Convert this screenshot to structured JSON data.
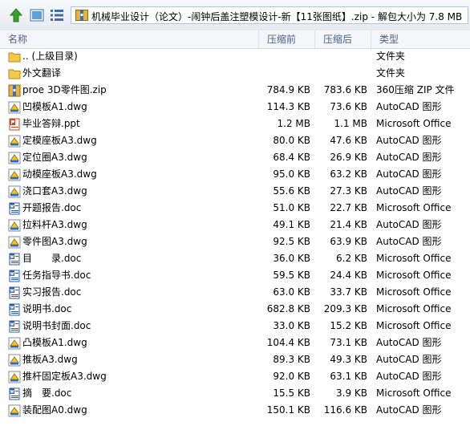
{
  "window": {
    "path": "机械毕业设计（论文）-闹钟后盖注塑模设计-新【11张图纸】.zip - 解包大小为 7.8 MB"
  },
  "toolbar": {
    "up_icon": "up-arrow-icon",
    "view1_icon": "thumbnail-view-icon",
    "view2_icon": "details-view-icon"
  },
  "columns": {
    "name": "名称",
    "packed": "压缩前",
    "size": "压缩后",
    "type": "类型"
  },
  "files": [
    {
      "name": ".. (上级目录)",
      "packed": "",
      "size": "",
      "type": "文件夹",
      "icon": "folder-icon"
    },
    {
      "name": "外文翻译",
      "packed": "",
      "size": "",
      "type": "文件夹",
      "icon": "folder-icon"
    },
    {
      "name": "proe 3D零件图.zip",
      "packed": "784.9 KB",
      "size": "783.6 KB",
      "type": "360压缩 ZIP 文件",
      "icon": "zip-icon"
    },
    {
      "name": "凹模板A1.dwg",
      "packed": "114.3 KB",
      "size": "73.6 KB",
      "type": "AutoCAD 图形",
      "icon": "dwg-icon"
    },
    {
      "name": "毕业答辩.ppt",
      "packed": "1.2 MB",
      "size": "1.1 MB",
      "type": "Microsoft Office",
      "icon": "ppt-icon"
    },
    {
      "name": "定模座板A3.dwg",
      "packed": "80.0 KB",
      "size": "47.6 KB",
      "type": "AutoCAD 图形",
      "icon": "dwg-icon"
    },
    {
      "name": "定位圈A3.dwg",
      "packed": "68.4 KB",
      "size": "26.9 KB",
      "type": "AutoCAD 图形",
      "icon": "dwg-icon"
    },
    {
      "name": "动模座板A3.dwg",
      "packed": "95.0 KB",
      "size": "63.2 KB",
      "type": "AutoCAD 图形",
      "icon": "dwg-icon"
    },
    {
      "name": "浇口套A3.dwg",
      "packed": "55.6 KB",
      "size": "27.3 KB",
      "type": "AutoCAD 图形",
      "icon": "dwg-icon"
    },
    {
      "name": "开题报告.doc",
      "packed": "51.0 KB",
      "size": "22.7 KB",
      "type": "Microsoft Office",
      "icon": "doc-icon"
    },
    {
      "name": "拉料杆A3.dwg",
      "packed": "49.1 KB",
      "size": "21.4 KB",
      "type": "AutoCAD 图形",
      "icon": "dwg-icon"
    },
    {
      "name": "零件图A3.dwg",
      "packed": "92.5 KB",
      "size": "63.9 KB",
      "type": "AutoCAD 图形",
      "icon": "dwg-icon"
    },
    {
      "name": "目　　录.doc",
      "packed": "36.0 KB",
      "size": "6.2 KB",
      "type": "Microsoft Office",
      "icon": "doc-icon"
    },
    {
      "name": "任务指导书.doc",
      "packed": "59.5 KB",
      "size": "24.4 KB",
      "type": "Microsoft Office",
      "icon": "doc-icon"
    },
    {
      "name": "实习报告.doc",
      "packed": "63.0 KB",
      "size": "33.7 KB",
      "type": "Microsoft Office",
      "icon": "doc-icon"
    },
    {
      "name": "说明书.doc",
      "packed": "682.8 KB",
      "size": "209.3 KB",
      "type": "Microsoft Office",
      "icon": "doc-icon"
    },
    {
      "name": "说明书封面.doc",
      "packed": "33.0 KB",
      "size": "15.2 KB",
      "type": "Microsoft Office",
      "icon": "doc-icon"
    },
    {
      "name": "凸模板A1.dwg",
      "packed": "104.4 KB",
      "size": "73.1 KB",
      "type": "AutoCAD 图形",
      "icon": "dwg-icon"
    },
    {
      "name": "推板A3.dwg",
      "packed": "89.3 KB",
      "size": "49.3 KB",
      "type": "AutoCAD 图形",
      "icon": "dwg-icon"
    },
    {
      "name": "推杆固定板A3.dwg",
      "packed": "92.0 KB",
      "size": "63.1 KB",
      "type": "AutoCAD 图形",
      "icon": "dwg-icon"
    },
    {
      "name": "摘　要.doc",
      "packed": "15.5 KB",
      "size": "3.9 KB",
      "type": "Microsoft Office",
      "icon": "doc-icon"
    },
    {
      "name": "装配图A0.dwg",
      "packed": "150.1 KB",
      "size": "116.6 KB",
      "type": "AutoCAD 图形",
      "icon": "dwg-icon"
    }
  ]
}
